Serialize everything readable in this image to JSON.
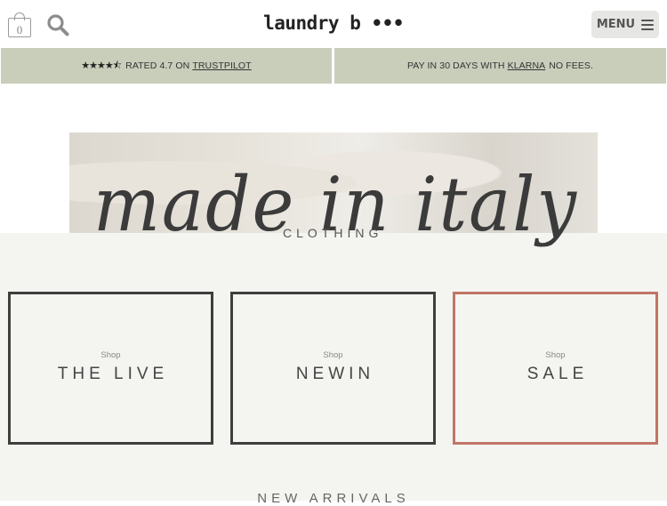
{
  "header": {
    "brand": "laundry b •••",
    "cart_count": "0",
    "menu_label": "MENU"
  },
  "promo": {
    "rating_prefix": "RATED 4.7 ON",
    "rating_link": "TRUSTPILOT",
    "pay_prefix": "PAY IN 30 DAYS WITH",
    "pay_link": "KLARNA",
    "pay_suffix": "NO FEES."
  },
  "hero": {
    "script_text": "made in italy",
    "subtitle": "CLOTHING"
  },
  "tiles": [
    {
      "shop": "Shop",
      "title": "THE LIVE"
    },
    {
      "shop": "Shop",
      "title": "NEWIN"
    },
    {
      "shop": "Shop",
      "title": "SALE"
    }
  ],
  "section": {
    "new_arrivals": "NEW ARRIVALS"
  },
  "colors": {
    "promo_bg": "#c9cebb",
    "sale_border": "#c07565",
    "tile_border": "#3e3e3e"
  }
}
